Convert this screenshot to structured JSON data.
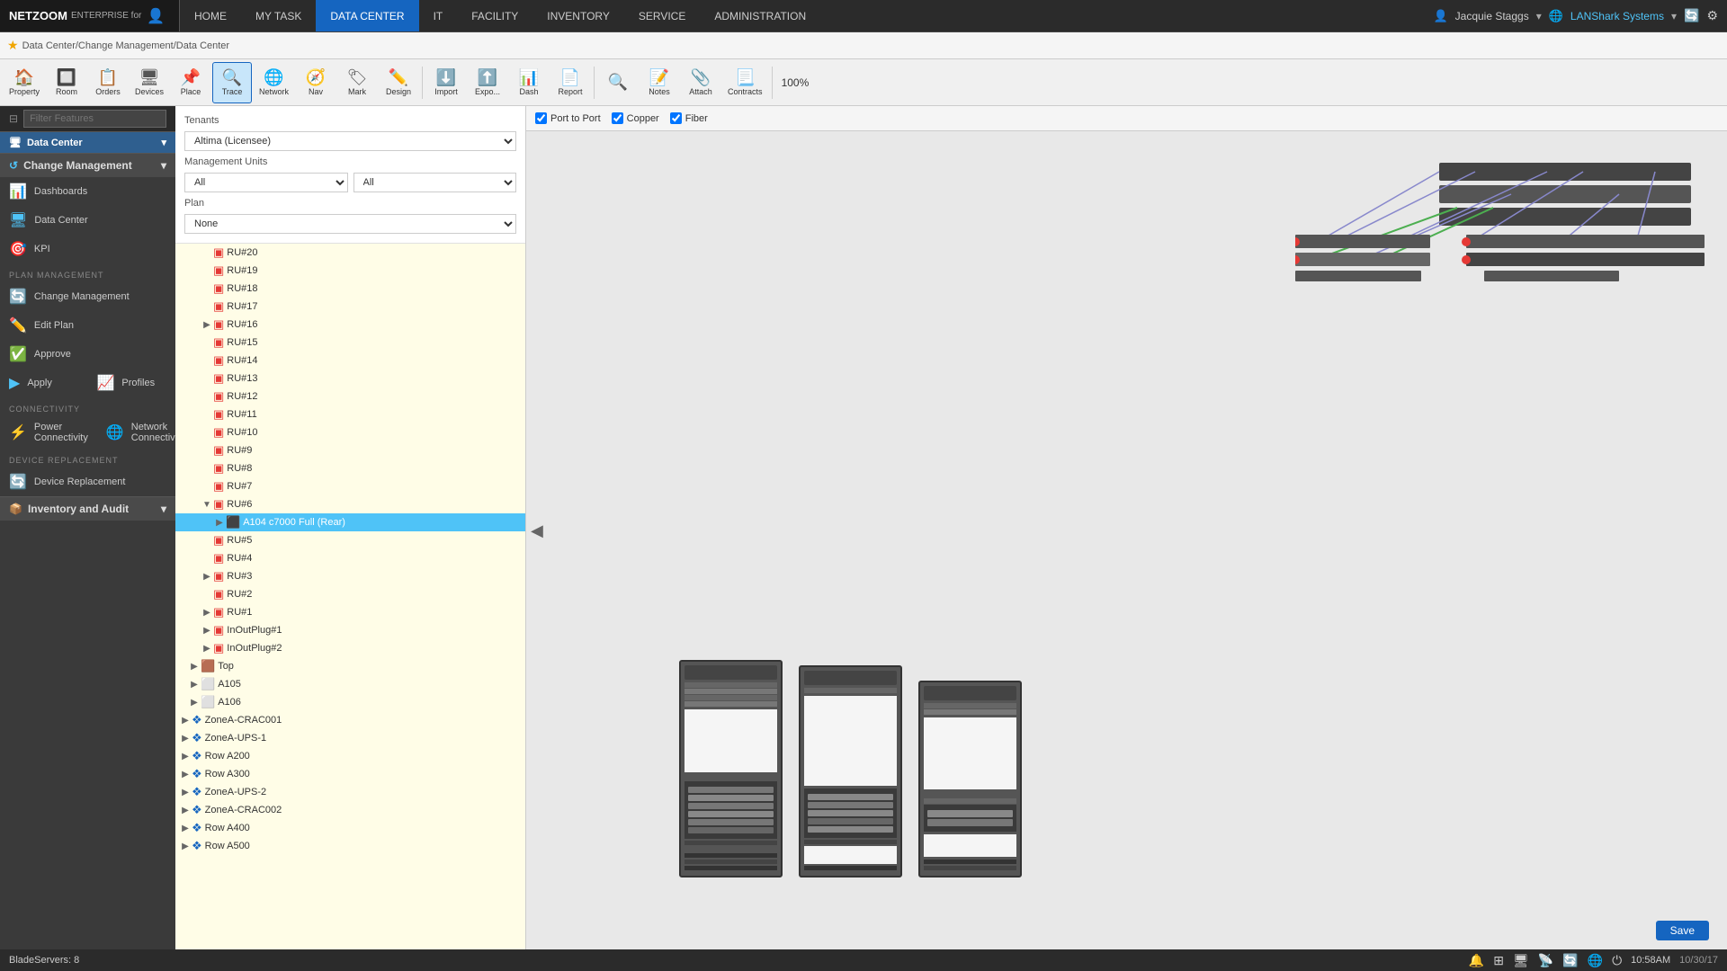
{
  "app": {
    "logo": "NETZOOM",
    "logo_sub": "ENTERPRISE for"
  },
  "nav": {
    "items": [
      {
        "label": "HOME",
        "active": false
      },
      {
        "label": "MY TASK",
        "active": false
      },
      {
        "label": "DATA CENTER",
        "active": true
      },
      {
        "label": "IT",
        "active": false
      },
      {
        "label": "FACILITY",
        "active": false
      },
      {
        "label": "INVENTORY",
        "active": false
      },
      {
        "label": "SERVICE",
        "active": false
      },
      {
        "label": "ADMINISTRATION",
        "active": false
      }
    ],
    "user": "Jacquie Staggs",
    "company": "LANShark Systems"
  },
  "breadcrumb": {
    "path": "Data Center/Change Management/Data Center"
  },
  "toolbar": {
    "buttons": [
      {
        "label": "Property",
        "icon": "🏠"
      },
      {
        "label": "Room",
        "icon": "🔲"
      },
      {
        "label": "Orders",
        "icon": "📋"
      },
      {
        "label": "Devices",
        "icon": "🖥"
      },
      {
        "label": "Place",
        "icon": "📌"
      },
      {
        "label": "Trace",
        "icon": "🔍",
        "active": true
      },
      {
        "label": "Network",
        "icon": "🌐"
      },
      {
        "label": "Nav",
        "icon": "🧭"
      },
      {
        "label": "Mark",
        "icon": "🏷"
      },
      {
        "label": "Design",
        "icon": "✏️"
      },
      {
        "label": "Import",
        "icon": "⬇️"
      },
      {
        "label": "Expo...",
        "icon": "⬆️"
      },
      {
        "label": "Dash",
        "icon": "📊"
      },
      {
        "label": "Report",
        "icon": "📄"
      },
      {
        "label": "🔍",
        "icon": "🔍"
      },
      {
        "label": "Notes",
        "icon": "📝"
      },
      {
        "label": "Attach",
        "icon": "📎"
      },
      {
        "label": "Contracts",
        "icon": "📃"
      }
    ],
    "zoom": "100%"
  },
  "sidebar": {
    "filter_placeholder": "Filter Features",
    "sections": [
      {
        "title": "Data Center",
        "icon": "🖥",
        "subsections": [
          {
            "label": "Change Management",
            "items": [
              {
                "icon": "📊",
                "label": "Dashboards"
              },
              {
                "icon": "🖥",
                "label": "Data Center"
              },
              {
                "icon": "🎯",
                "label": "KPI"
              }
            ]
          }
        ]
      }
    ],
    "plan_management": {
      "label": "PLAN MANAGEMENT",
      "items": [
        {
          "icon": "🔄",
          "label": "Change Management"
        },
        {
          "icon": "✏️",
          "label": "Edit Plan"
        },
        {
          "icon": "✅",
          "label": "Approve"
        },
        {
          "icon": "▶",
          "label": "Apply"
        },
        {
          "icon": "📈",
          "label": "KPI Profiles"
        }
      ]
    },
    "connectivity": {
      "label": "CONNECTIVITY",
      "items": [
        {
          "icon": "⚡",
          "label": "Power Connectivity"
        },
        {
          "icon": "🌐",
          "label": "Network Connectivity"
        }
      ]
    },
    "device_replacement": {
      "label": "DEVICE REPLACEMENT",
      "items": [
        {
          "icon": "🔄",
          "label": "Device Replacement"
        }
      ]
    },
    "inventory_audit": {
      "label": "Inventory and Audit"
    }
  },
  "form": {
    "tenants_label": "Tenants",
    "tenants_value": "Altima (Licensee)",
    "management_units_label": "Management Units",
    "management_units_value1": "All",
    "management_units_value2": "All",
    "plan_label": "Plan",
    "plan_value": "None"
  },
  "canvas": {
    "port_to_port": true,
    "copper": true,
    "fiber": true,
    "port_to_port_label": "Port to Port",
    "copper_label": "Copper",
    "fiber_label": "Fiber"
  },
  "tree": {
    "nodes": [
      {
        "label": "RU#20",
        "indent": 2,
        "icon": "🟥",
        "expand": false
      },
      {
        "label": "RU#19",
        "indent": 2,
        "icon": "🟥",
        "expand": false
      },
      {
        "label": "RU#18",
        "indent": 2,
        "icon": "🟥",
        "expand": false
      },
      {
        "label": "RU#17",
        "indent": 2,
        "icon": "🟥",
        "expand": false
      },
      {
        "label": "RU#16",
        "indent": 2,
        "icon": "🟥",
        "expand": true
      },
      {
        "label": "RU#15",
        "indent": 2,
        "icon": "🟥",
        "expand": false
      },
      {
        "label": "RU#14",
        "indent": 2,
        "icon": "🟥",
        "expand": false
      },
      {
        "label": "RU#13",
        "indent": 2,
        "icon": "🟥",
        "expand": false
      },
      {
        "label": "RU#12",
        "indent": 2,
        "icon": "🟥",
        "expand": false
      },
      {
        "label": "RU#11",
        "indent": 2,
        "icon": "🟥",
        "expand": false
      },
      {
        "label": "RU#10",
        "indent": 2,
        "icon": "🟥",
        "expand": false
      },
      {
        "label": "RU#9",
        "indent": 2,
        "icon": "🟥",
        "expand": false
      },
      {
        "label": "RU#8",
        "indent": 2,
        "icon": "🟥",
        "expand": false
      },
      {
        "label": "RU#7",
        "indent": 2,
        "icon": "🟥",
        "expand": false
      },
      {
        "label": "RU#6",
        "indent": 2,
        "icon": "🟥",
        "expand": true
      },
      {
        "label": "A104 c7000 Full (Rear)",
        "indent": 3,
        "icon": "🟦",
        "expand": false,
        "selected": true
      },
      {
        "label": "RU#5",
        "indent": 2,
        "icon": "🟥",
        "expand": false
      },
      {
        "label": "RU#4",
        "indent": 2,
        "icon": "🟥",
        "expand": false
      },
      {
        "label": "RU#3",
        "indent": 2,
        "icon": "🟥",
        "expand": true
      },
      {
        "label": "RU#2",
        "indent": 2,
        "icon": "🟥",
        "expand": false
      },
      {
        "label": "RU#1",
        "indent": 2,
        "icon": "🟥",
        "expand": true
      },
      {
        "label": "InOutPlug#1",
        "indent": 2,
        "icon": "🟥",
        "expand": true
      },
      {
        "label": "InOutPlug#2",
        "indent": 2,
        "icon": "🟥",
        "expand": true
      },
      {
        "label": "Top",
        "indent": 1,
        "icon": "🟫",
        "expand": true
      },
      {
        "label": "A105",
        "indent": 1,
        "icon": "⬜",
        "expand": true
      },
      {
        "label": "A106",
        "indent": 1,
        "icon": "⬜",
        "expand": true
      },
      {
        "label": "ZoneA-CRAC001",
        "indent": 1,
        "icon": "🔷",
        "expand": true
      },
      {
        "label": "ZoneA-UPS-1",
        "indent": 1,
        "icon": "🔷",
        "expand": true
      },
      {
        "label": "Row A200",
        "indent": 1,
        "icon": "🔷",
        "expand": true
      },
      {
        "label": "Row A300",
        "indent": 1,
        "icon": "🔷",
        "expand": true
      },
      {
        "label": "ZoneA-UPS-2",
        "indent": 1,
        "icon": "🔷",
        "expand": true
      },
      {
        "label": "ZoneA-CRAC002",
        "indent": 1,
        "icon": "🔷",
        "expand": true
      },
      {
        "label": "Row A400",
        "indent": 1,
        "icon": "🔷",
        "expand": true
      },
      {
        "label": "Row A500",
        "indent": 1,
        "icon": "🔷",
        "expand": true
      }
    ]
  },
  "status": {
    "blade_servers": "BladeServers: 8",
    "time": "10:58AM",
    "date": "10/30/17",
    "save_label": "Save"
  }
}
